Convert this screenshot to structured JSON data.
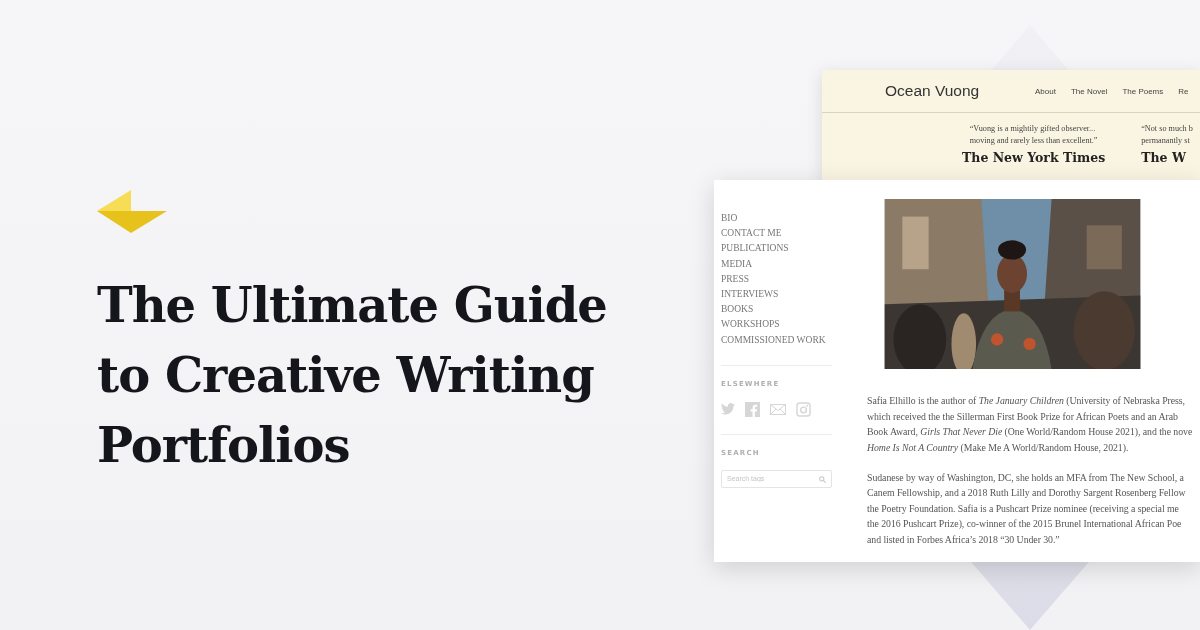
{
  "headline": {
    "lines": [
      "The Ultimate Guide",
      "to Creative Writing",
      "Portfolios"
    ]
  },
  "back_site": {
    "title": "Ocean Vuong",
    "nav": [
      "About",
      "The Novel",
      "The Poems",
      "Re"
    ],
    "reviews": [
      {
        "quote_lines": [
          "“Vuong is a mightily gifted observer...",
          "moving and rarely less than excellent.”"
        ],
        "source": "The New York Times"
      },
      {
        "quote_lines": [
          "“Not so much b",
          "permanantly st"
        ],
        "source": "The W"
      }
    ]
  },
  "front_site": {
    "sidebar": {
      "menu": [
        "BIO",
        "CONTACT ME",
        "PUBLICATIONS",
        "MEDIA",
        "PRESS",
        "INTERVIEWS",
        "BOOKS",
        "WORKSHOPS",
        "COMMISSIONED WORK"
      ],
      "elsewhere_heading": "ELSEWHERE",
      "search_heading": "SEARCH",
      "search": {
        "placeholder": "Search tags"
      }
    },
    "bio": {
      "paragraphs": [
        [
          "Safia Elhillo is the author of *The January Children* (University of Nebraska Press,",
          "which received the the Sillerman First Book Prize for African Poets and an Arab",
          "Book Award, *Girls That Never Die* (One World/Random House 2021), and the nove",
          "*Home Is Not A Country* (Make Me A World/Random House, 2021)."
        ],
        [
          "Sudanese by way of Washington, DC, she holds an MFA from The New School, a",
          "Canem Fellowship, and a 2018 Ruth Lilly and Dorothy Sargent Rosenberg Fellow",
          "the Poetry Foundation. Safia is a Pushcart Prize nominee (receiving a special me",
          "the 2016 Pushcart Prize), co-winner of the 2015 Brunel International African Poe",
          "and listed in Forbes Africa’s 2018 “30 Under 30.”"
        ]
      ]
    }
  }
}
